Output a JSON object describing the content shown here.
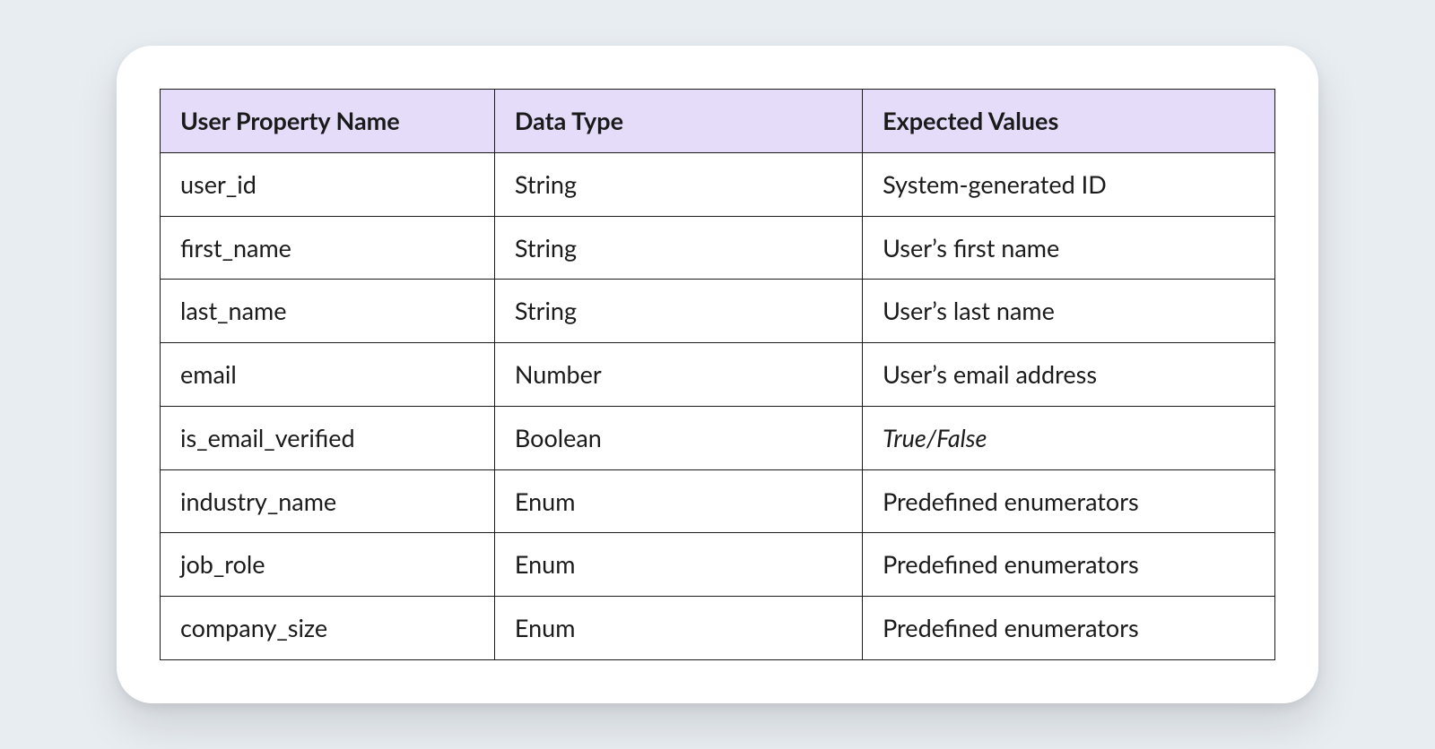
{
  "chart_data": {
    "type": "table",
    "headers": [
      "User Property Name",
      "Data Type",
      "Expected Values"
    ],
    "rows": [
      {
        "name": "user_id",
        "type": "String",
        "expected": "System-generated ID",
        "italic": false
      },
      {
        "name": "first_name",
        "type": "String",
        "expected": "User’s first name",
        "italic": false
      },
      {
        "name": "last_name",
        "type": "String",
        "expected": "User’s last name",
        "italic": false
      },
      {
        "name": "email",
        "type": "Number",
        "expected": "User’s email address",
        "italic": false
      },
      {
        "name": "is_email_verified",
        "type": "Boolean",
        "expected": "True/False",
        "italic": true
      },
      {
        "name": "industry_name",
        "type": "Enum",
        "expected": "Predefined enumerators",
        "italic": false
      },
      {
        "name": "job_role",
        "type": "Enum",
        "expected": "Predefined enumerators",
        "italic": false
      },
      {
        "name": "company_size",
        "type": "Enum",
        "expected": "Predefined enumerators",
        "italic": false
      }
    ]
  }
}
